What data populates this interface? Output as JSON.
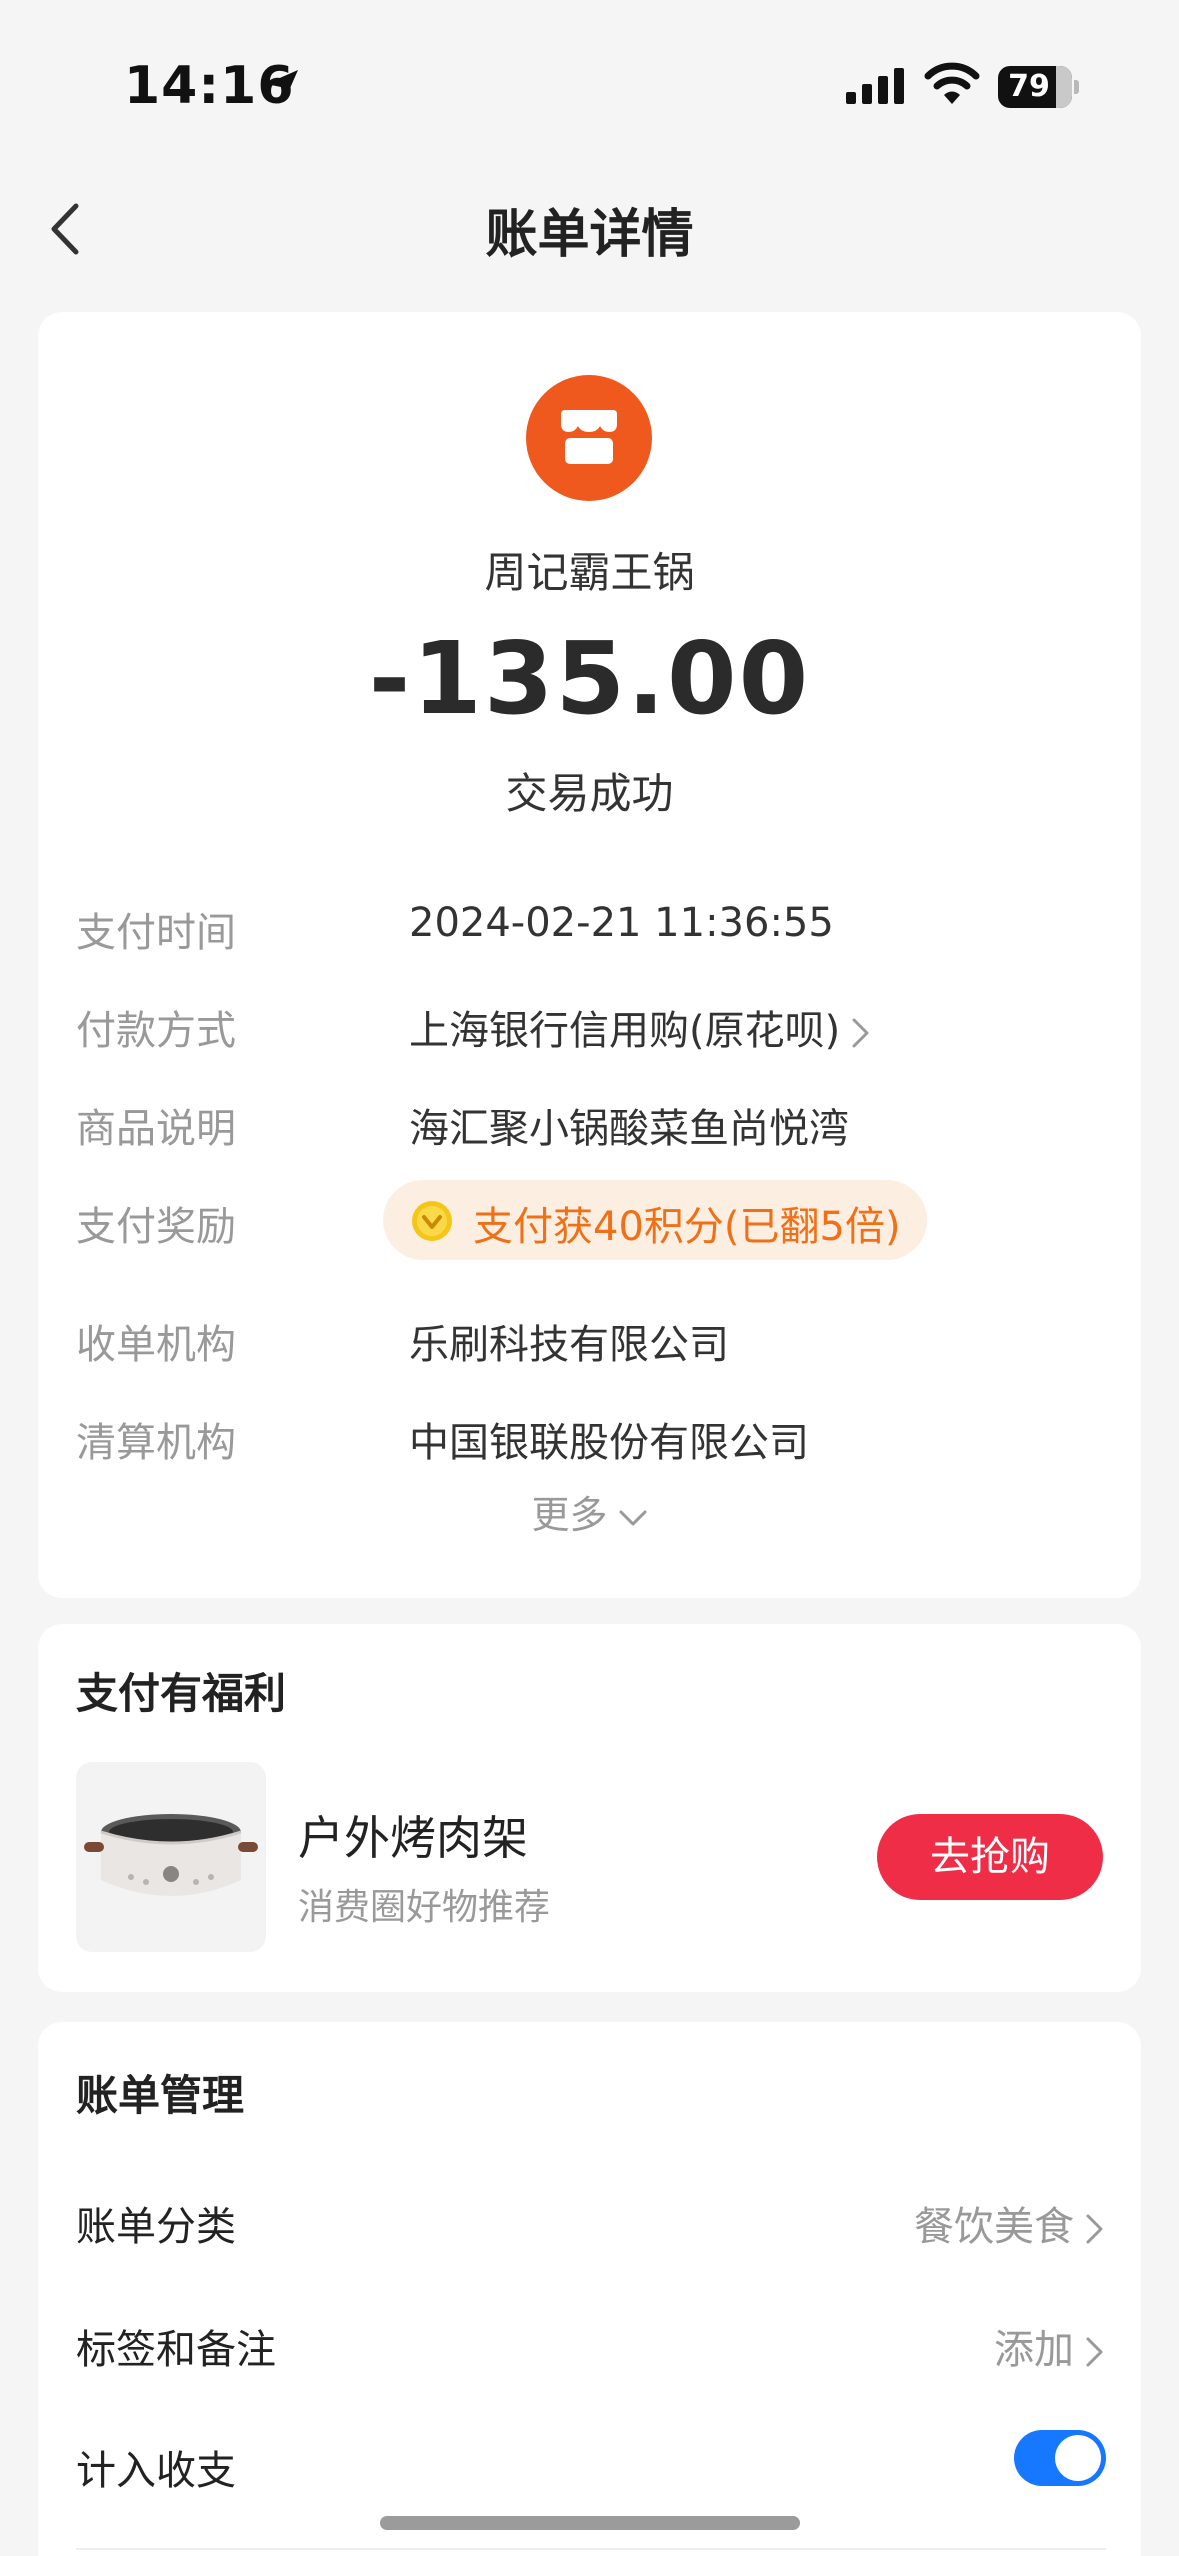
{
  "status_bar": {
    "time": "14:16",
    "battery": "79",
    "battery_level": 0.79
  },
  "nav": {
    "title": "账单详情"
  },
  "summary": {
    "merchant": "周记霸王锅",
    "amount": "-135.00",
    "status": "交易成功",
    "logo_color": "#f0591e"
  },
  "details": [
    {
      "label": "支付时间",
      "value": "2024-02-21 11:36:55"
    },
    {
      "label": "付款方式",
      "value": "上海银行信用购(原花呗)"
    },
    {
      "label": "商品说明",
      "value": "海汇聚小锅酸菜鱼尚悦湾"
    },
    {
      "label": "支付奖励",
      "value": "支付获40积分(已翻5倍)"
    },
    {
      "label": "收单机构",
      "value": "乐刷科技有限公司"
    },
    {
      "label": "清算机构",
      "value": "中国银联股份有限公司"
    }
  ],
  "more_label": "更多",
  "benefit": {
    "title": "支付有福利",
    "product_name": "户外烤肉架",
    "product_sub": "消费圈好物推荐",
    "buy_label": "去抢购",
    "buy_color": "#f02d47"
  },
  "manage": {
    "title": "账单管理",
    "category_label": "账单分类",
    "category_value": "餐饮美食",
    "tags_label": "标签和备注",
    "tags_value": "添加",
    "include_label": "计入收支",
    "include_on": true
  },
  "colors": {
    "accent": "#1677ff",
    "reward": "#f07017"
  }
}
